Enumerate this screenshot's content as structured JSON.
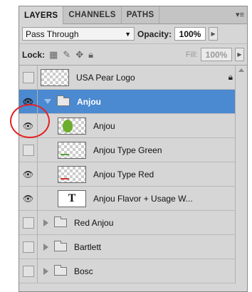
{
  "tabs": {
    "layers": "LAYERS",
    "channels": "CHANNELS",
    "paths": "PATHS",
    "menu_icon": "▾≡"
  },
  "blend": {
    "mode": "Pass Through",
    "opacity_label": "Opacity:",
    "opacity_value": "100%"
  },
  "lock": {
    "label": "Lock:",
    "fill_label": "Fill:",
    "fill_value": "100%"
  },
  "layers": [
    {
      "name": "USA Pear Logo",
      "visible": false,
      "locked": true
    },
    {
      "name": "Anjou",
      "visible": true,
      "group": true,
      "expanded": true,
      "selected": true
    },
    {
      "name": "Anjou",
      "visible": true
    },
    {
      "name": "Anjou Type Green",
      "visible": false
    },
    {
      "name": "Anjou Type Red",
      "visible": true
    },
    {
      "name": "Anjou Flavor + Usage W...",
      "visible": true,
      "text_layer": true,
      "thumb_text": "T"
    },
    {
      "name": "Red Anjou",
      "visible": false,
      "group": true
    },
    {
      "name": "Bartlett",
      "visible": false,
      "group": true
    },
    {
      "name": "Bosc",
      "visible": false,
      "group": true
    }
  ],
  "colors": {
    "selection": "#4b89d0",
    "annotation": "#e42222"
  }
}
